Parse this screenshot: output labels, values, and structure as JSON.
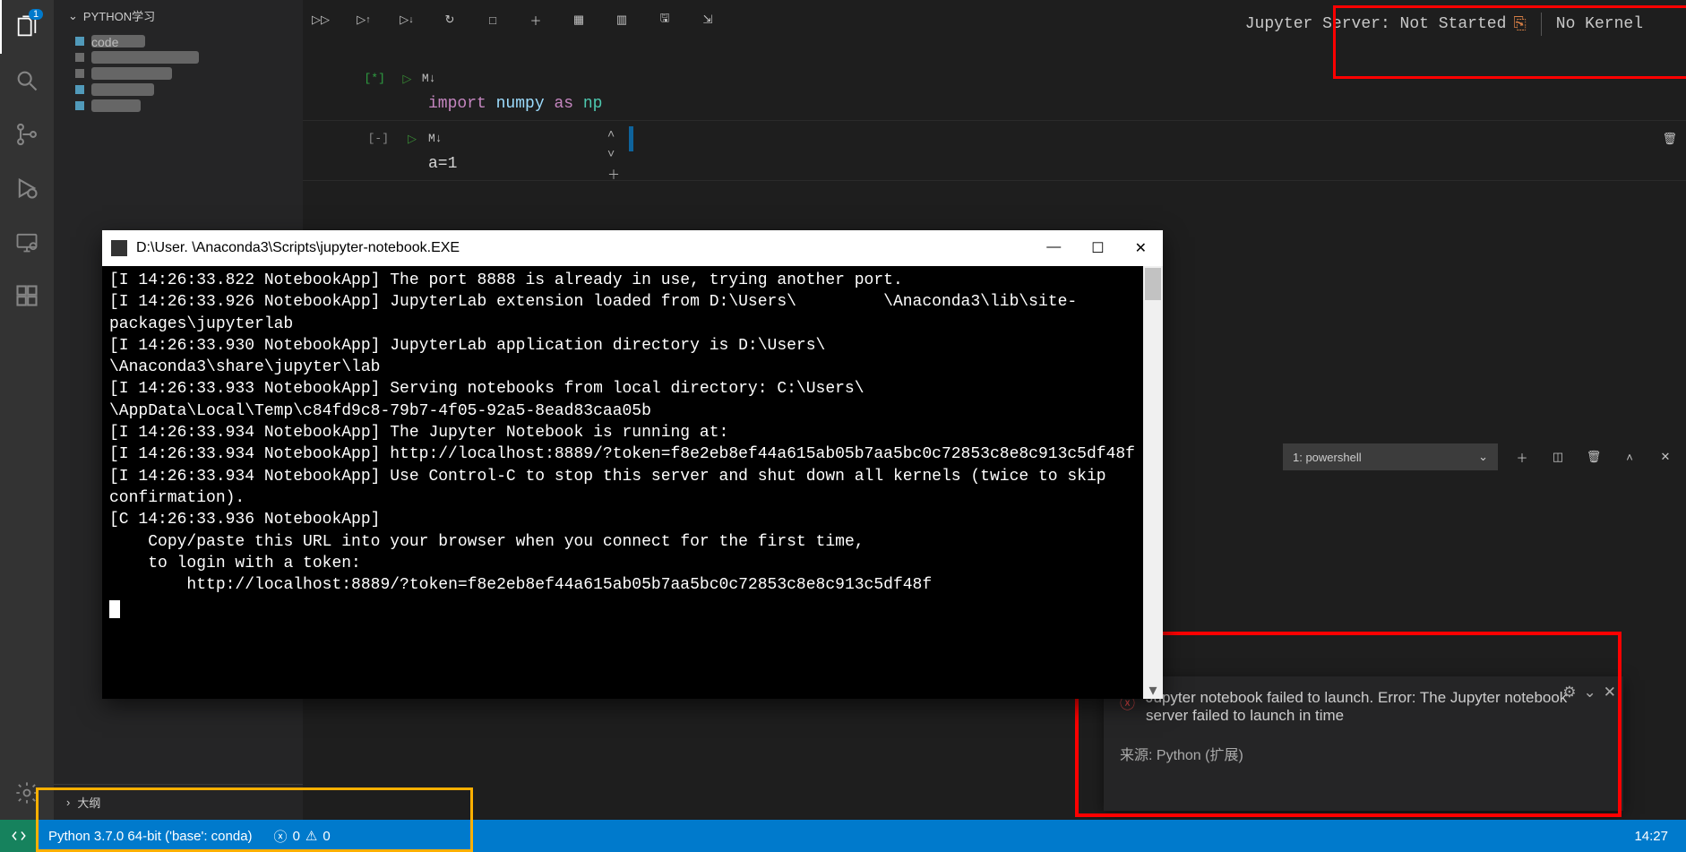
{
  "activity": {
    "explorer_badge": "1"
  },
  "sidebar": {
    "header": "PYTHON学习",
    "items": [
      "code",
      "",
      "",
      "",
      ""
    ],
    "outline": "大纲"
  },
  "notebook": {
    "jupyter_status": "Jupyter Server: Not Started",
    "kernel": "No Kernel",
    "cell1": {
      "prompt": "[*]",
      "md": "M↓",
      "code_import": "import",
      "code_mod": "numpy",
      "code_as": "as",
      "code_alias": "np"
    },
    "cell2": {
      "prompt": "[-]",
      "md": "M↓",
      "code": "a=1"
    }
  },
  "cmd": {
    "title": "D:\\User.        \\Anaconda3\\Scripts\\jupyter-notebook.EXE",
    "lines": [
      "[I 14:26:33.822 NotebookApp] The port 8888 is already in use, trying another port.",
      "[I 14:26:33.926 NotebookApp] JupyterLab extension loaded from D:\\Users\\         \\Anaconda3\\lib\\site-packages\\jupyterlab",
      "[I 14:26:33.930 NotebookApp] JupyterLab application directory is D:\\Users\\        \\Anaconda3\\share\\jupyter\\lab",
      "[I 14:26:33.933 NotebookApp] Serving notebooks from local directory: C:\\Users\\        \\AppData\\Local\\Temp\\c84fd9c8-79b7-4f05-92a5-8ead83caa05b",
      "[I 14:26:33.934 NotebookApp] The Jupyter Notebook is running at:",
      "[I 14:26:33.934 NotebookApp] http://localhost:8889/?token=f8e2eb8ef44a615ab05b7aa5bc0c72853c8e8c913c5df48f",
      "[I 14:26:33.934 NotebookApp] Use Control-C to stop this server and shut down all kernels (twice to skip confirmation).",
      "[C 14:26:33.936 NotebookApp]",
      "",
      "    Copy/paste this URL into your browser when you connect for the first time,",
      "    to login with a token:",
      "        http://localhost:8889/?token=f8e2eb8ef44a615ab05b7aa5bc0c72853c8e8c913c5df48f"
    ]
  },
  "terminal": {
    "select": "1: powershell"
  },
  "notification": {
    "text": "Jupyter notebook failed to launch. Error: The Jupyter notebook server failed to launch in time",
    "source": "来源: Python (扩展)"
  },
  "status": {
    "remote": "",
    "python": "Python 3.7.0 64-bit ('base': conda)",
    "errors": "0",
    "warnings": "0",
    "clock": "14:27"
  }
}
